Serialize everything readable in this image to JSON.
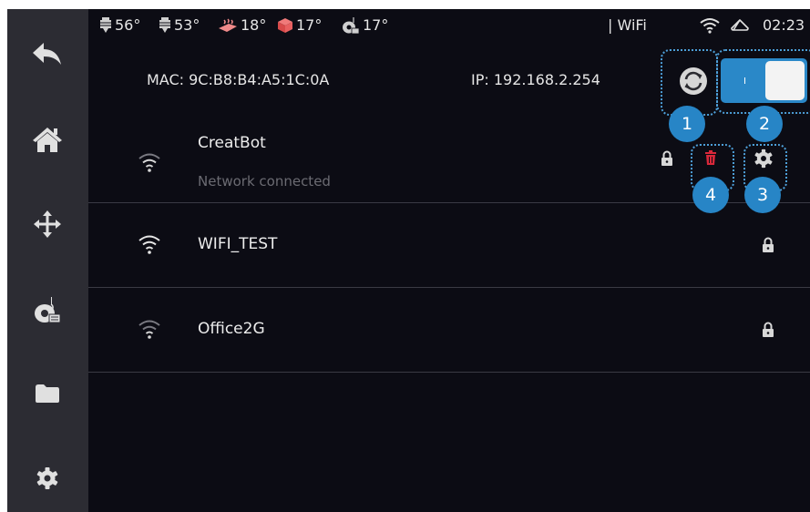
{
  "status_bar": {
    "temps": [
      {
        "icon": "nozzle-1-icon",
        "value": "56°"
      },
      {
        "icon": "nozzle-2-icon",
        "value": "53°"
      },
      {
        "icon": "heated-bed-icon",
        "value": "18°"
      },
      {
        "icon": "chamber-icon",
        "value": "17°"
      },
      {
        "icon": "filament-spool-icon",
        "value": "17°"
      }
    ],
    "connection_label": "| WiFi",
    "time": "02:23"
  },
  "sidebar": {
    "items": [
      {
        "name": "back",
        "icon": "back-arrow-icon"
      },
      {
        "name": "home",
        "icon": "home-icon"
      },
      {
        "name": "move",
        "icon": "move-arrows-icon"
      },
      {
        "name": "filament",
        "icon": "filament-spool-icon"
      },
      {
        "name": "files",
        "icon": "folder-icon"
      },
      {
        "name": "settings",
        "icon": "gear-icon"
      }
    ]
  },
  "network": {
    "mac": "MAC: 9C:B8:B4:A5:1C:0A",
    "ip": "IP: 192.168.2.254",
    "wifi_enabled": true
  },
  "annotations": [
    "1",
    "2",
    "3",
    "4"
  ],
  "networks": [
    {
      "ssid": "CreatBot",
      "status": "Network connected",
      "secured": true
    },
    {
      "ssid": "WIFI_TEST",
      "status": "",
      "secured": true
    },
    {
      "ssid": "Office2G",
      "status": "",
      "secured": true
    }
  ],
  "colors": {
    "background": "#0c0c14",
    "sidebar": "#2c2c33",
    "accent": "#2a88c8",
    "badge": "#2785c6",
    "delete": "#d8283a"
  }
}
